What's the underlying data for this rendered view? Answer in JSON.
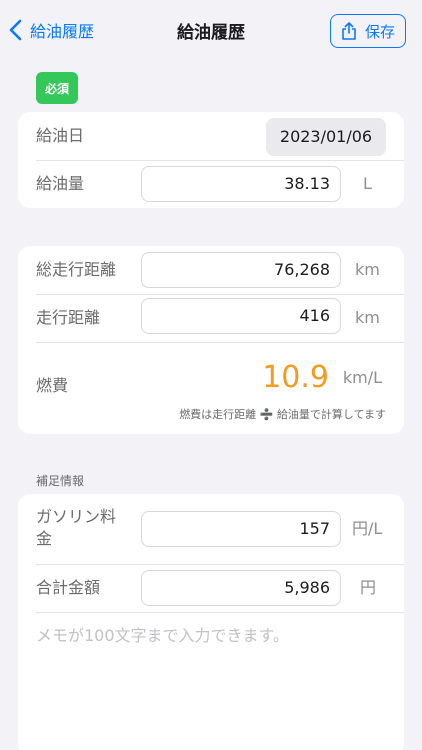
{
  "nav": {
    "back_label": "給油履歴",
    "title": "給油履歴",
    "save_label": "保存"
  },
  "badge": "必須",
  "refuel": {
    "date_label": "給油日",
    "date_value": "2023/01/06",
    "amount_label": "給油量",
    "amount_value": "38.13",
    "amount_unit": "L"
  },
  "distance": {
    "odometer_label": "総走行距離",
    "odometer_value": "76,268",
    "odometer_unit": "km",
    "trip_label": "走行距離",
    "trip_value": "416",
    "trip_unit": "km",
    "economy_label": "燃費",
    "economy_value": "10.9",
    "economy_unit": "km/L",
    "economy_note": "燃費は走行距離 ➗ 給油量で計算してます"
  },
  "extra": {
    "section_title": "補足情報",
    "price_label": "ガソリン料金",
    "price_value": "157",
    "price_unit": "円/L",
    "total_label": "合計金額",
    "total_value": "5,986",
    "total_unit": "円",
    "memo_placeholder": "メモが100文字まで入力できます。"
  },
  "colors": {
    "accent": "#0a7aff",
    "required_badge": "#34c759",
    "economy": "#f39b1e",
    "background": "#f2f2f7"
  }
}
